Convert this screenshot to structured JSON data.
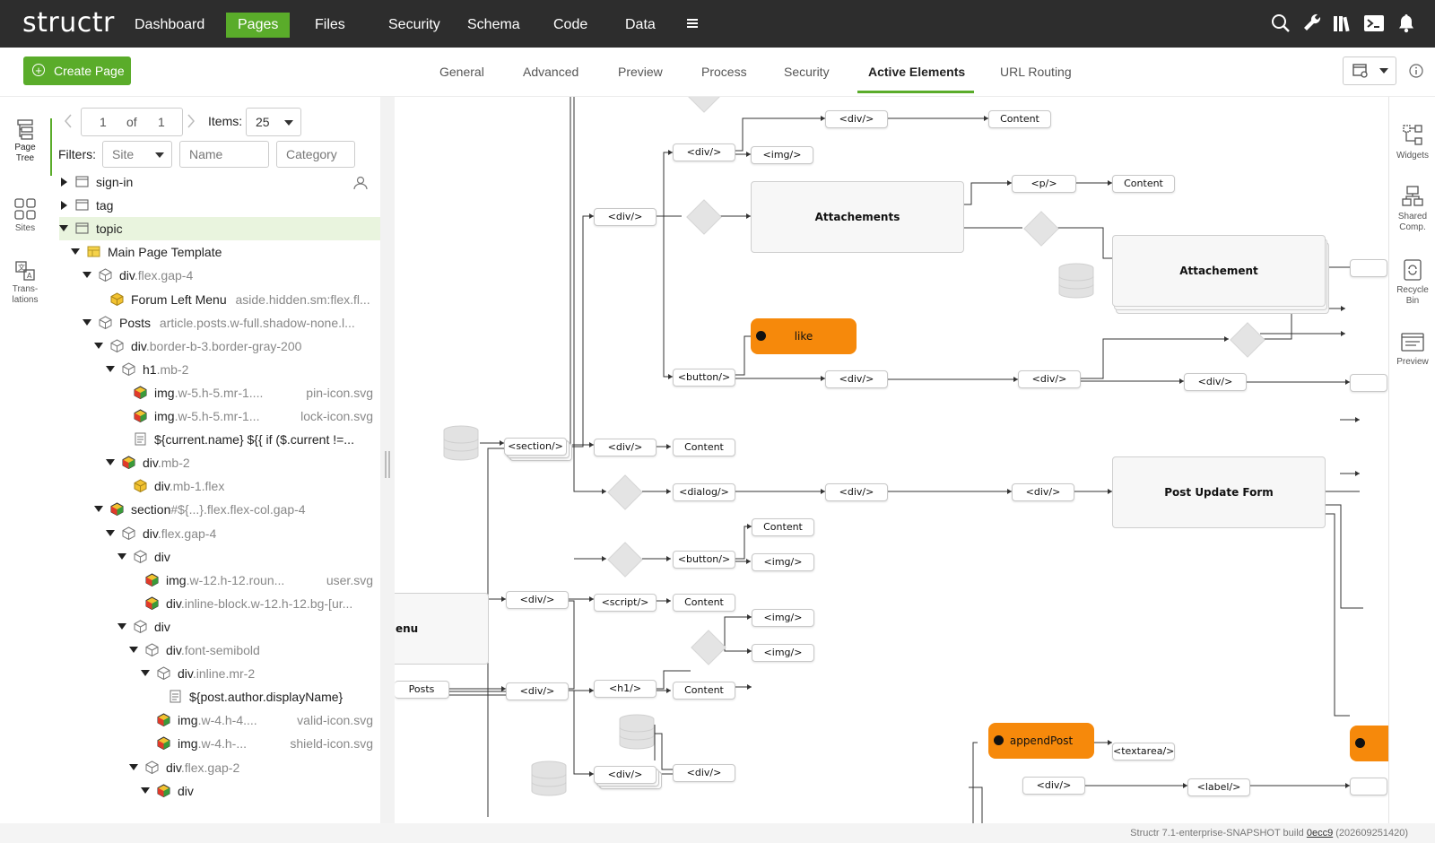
{
  "app": {
    "logo": "structr"
  },
  "nav": {
    "items": [
      "Dashboard",
      "Pages",
      "Files",
      "Security",
      "Schema",
      "Code",
      "Data"
    ],
    "active": "Pages"
  },
  "toolbar": {
    "create_label": "Create Page"
  },
  "tabs": [
    "General",
    "Advanced",
    "Preview",
    "Process",
    "Security",
    "Active Elements",
    "URL Routing"
  ],
  "active_tab": "Active Elements",
  "left_rail": [
    "Page Tree",
    "Sites",
    "Trans-lations"
  ],
  "right_rail": [
    "Widgets",
    "Shared Comp.",
    "Recycle Bin",
    "Preview"
  ],
  "pager": {
    "page": "1",
    "of_label": "of",
    "total": "1",
    "items_label": "Items:",
    "items_value": "25"
  },
  "filters": {
    "label": "Filters:",
    "site": "Site",
    "name": "Name",
    "category": "Category"
  },
  "tree": [
    {
      "label": "sign-in",
      "cls": "",
      "trail": ""
    },
    {
      "label": "tag",
      "cls": "",
      "trail": ""
    },
    {
      "label": "topic",
      "cls": "",
      "trail": ""
    },
    {
      "label": "Main Page Template",
      "cls": "",
      "trail": ""
    },
    {
      "label": "div",
      "cls": ".flex.gap-4",
      "trail": ""
    },
    {
      "label": "Forum Left Menu",
      "cls": "aside.hidden.sm:flex.fl...",
      "trail": ""
    },
    {
      "label": "Posts",
      "cls": "article.posts.w-full.shadow-none.l...",
      "trail": ""
    },
    {
      "label": "div",
      "cls": ".border-b-3.border-gray-200",
      "trail": ""
    },
    {
      "label": "h1",
      "cls": ".mb-2",
      "trail": ""
    },
    {
      "label": "img",
      "cls": ".w-5.h-5.mr-1....",
      "trail": "pin-icon.svg"
    },
    {
      "label": "img",
      "cls": ".w-5.h-5.mr-1...",
      "trail": "lock-icon.svg"
    },
    {
      "label": "${current.name} ${{ if ($.current !=...",
      "cls": "",
      "trail": ""
    },
    {
      "label": "div",
      "cls": ".mb-2",
      "trail": ""
    },
    {
      "label": "div",
      "cls": ".mb-1.flex",
      "trail": ""
    },
    {
      "label": "section",
      "cls": "#${...}.flex.flex-col.gap-4",
      "trail": ""
    },
    {
      "label": "div",
      "cls": ".flex.gap-4",
      "trail": ""
    },
    {
      "label": "div",
      "cls": "",
      "trail": ""
    },
    {
      "label": "img",
      "cls": ".w-12.h-12.roun...",
      "trail": "user.svg"
    },
    {
      "label": "div",
      "cls": ".inline-block.w-12.h-12.bg-[ur...",
      "trail": ""
    },
    {
      "label": "div",
      "cls": "",
      "trail": ""
    },
    {
      "label": "div",
      "cls": ".font-semibold",
      "trail": ""
    },
    {
      "label": "div",
      "cls": ".inline.mr-2",
      "trail": ""
    },
    {
      "label": "${post.author.displayName}",
      "cls": "",
      "trail": ""
    },
    {
      "label": "img",
      "cls": ".w-4.h-4....",
      "trail": "valid-icon.svg"
    },
    {
      "label": "img",
      "cls": ".w-4.h-...",
      "trail": "shield-icon.svg"
    },
    {
      "label": "div",
      "cls": ".flex.gap-2",
      "trail": ""
    },
    {
      "label": "div",
      "cls": "",
      "trail": ""
    }
  ],
  "flow": {
    "small_nodes": [
      "<div/>",
      "Content",
      "<div/>",
      "<img/>",
      "<div/>",
      "<p/>",
      "Content",
      "<button/>",
      "<div/>",
      "<div/>",
      "<div/>",
      "<section/>",
      "<div/>",
      "Content",
      "<dialog/>",
      "<div/>",
      "<div/>",
      "Content",
      "<button/>",
      "<img/>",
      "<div/>",
      "<script/>",
      "Content",
      "<img/>",
      "<img/>",
      "Posts",
      "<div/>",
      "<h1/>",
      "Content",
      "<div/>",
      "<div/>",
      "<textarea/>",
      "<div/>",
      "<label/>"
    ],
    "big_nodes": [
      "Attachements",
      "Attachement",
      "Post Update Form",
      "enu"
    ],
    "action_nodes": [
      "like",
      "appendPost"
    ]
  },
  "footer": {
    "text": "Structr 7.1-enterprise-SNAPSHOT build",
    "build": "0ecc9",
    "date": "(202609251420)"
  }
}
